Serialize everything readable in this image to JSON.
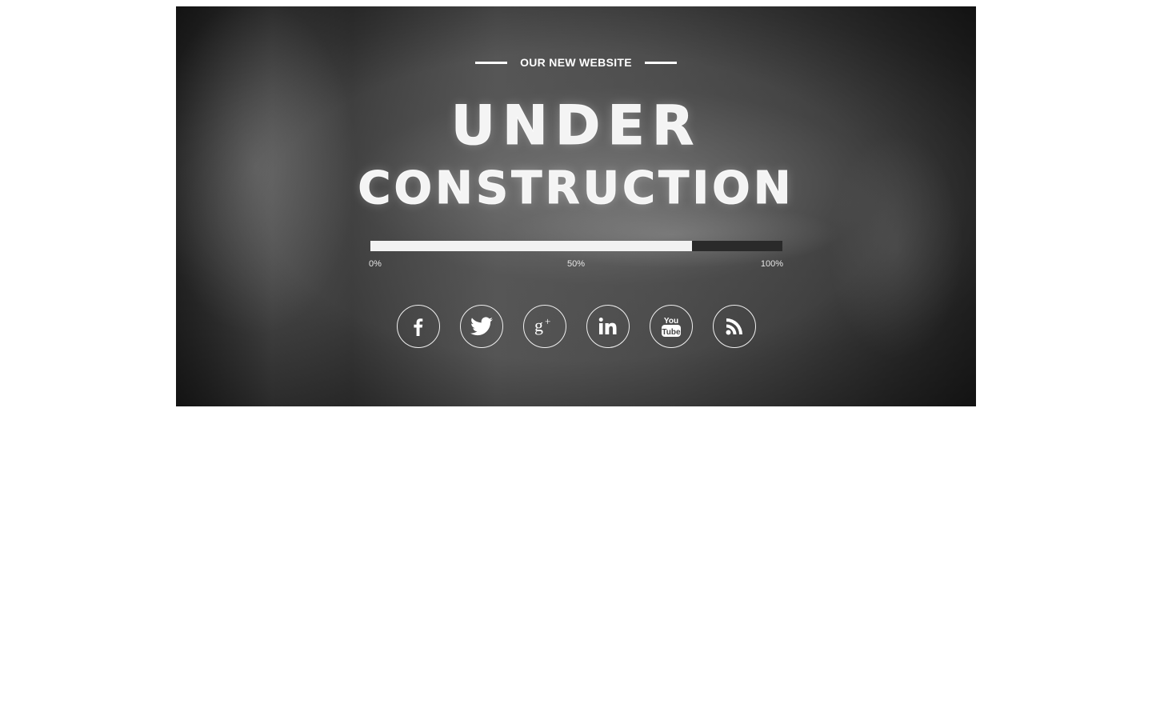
{
  "header": {
    "tagline": "OUR NEW WEBSITE"
  },
  "hero": {
    "title_line1": "UNDER",
    "title_line2": "CONSTRUCTION"
  },
  "progress": {
    "value_percent": 78,
    "label_min": "0%",
    "label_mid": "50%",
    "label_max": "100%"
  },
  "social": [
    {
      "name": "facebook",
      "icon": "facebook-icon"
    },
    {
      "name": "twitter",
      "icon": "twitter-icon"
    },
    {
      "name": "google-plus",
      "icon": "google-plus-icon"
    },
    {
      "name": "linkedin",
      "icon": "linkedin-icon"
    },
    {
      "name": "youtube",
      "icon": "youtube-icon"
    },
    {
      "name": "rss",
      "icon": "rss-icon"
    }
  ],
  "colors": {
    "text": "#ffffff",
    "progress_fill": "#f2f2f2",
    "progress_track": "#2a2a2a",
    "page_background": "#ffffff"
  }
}
